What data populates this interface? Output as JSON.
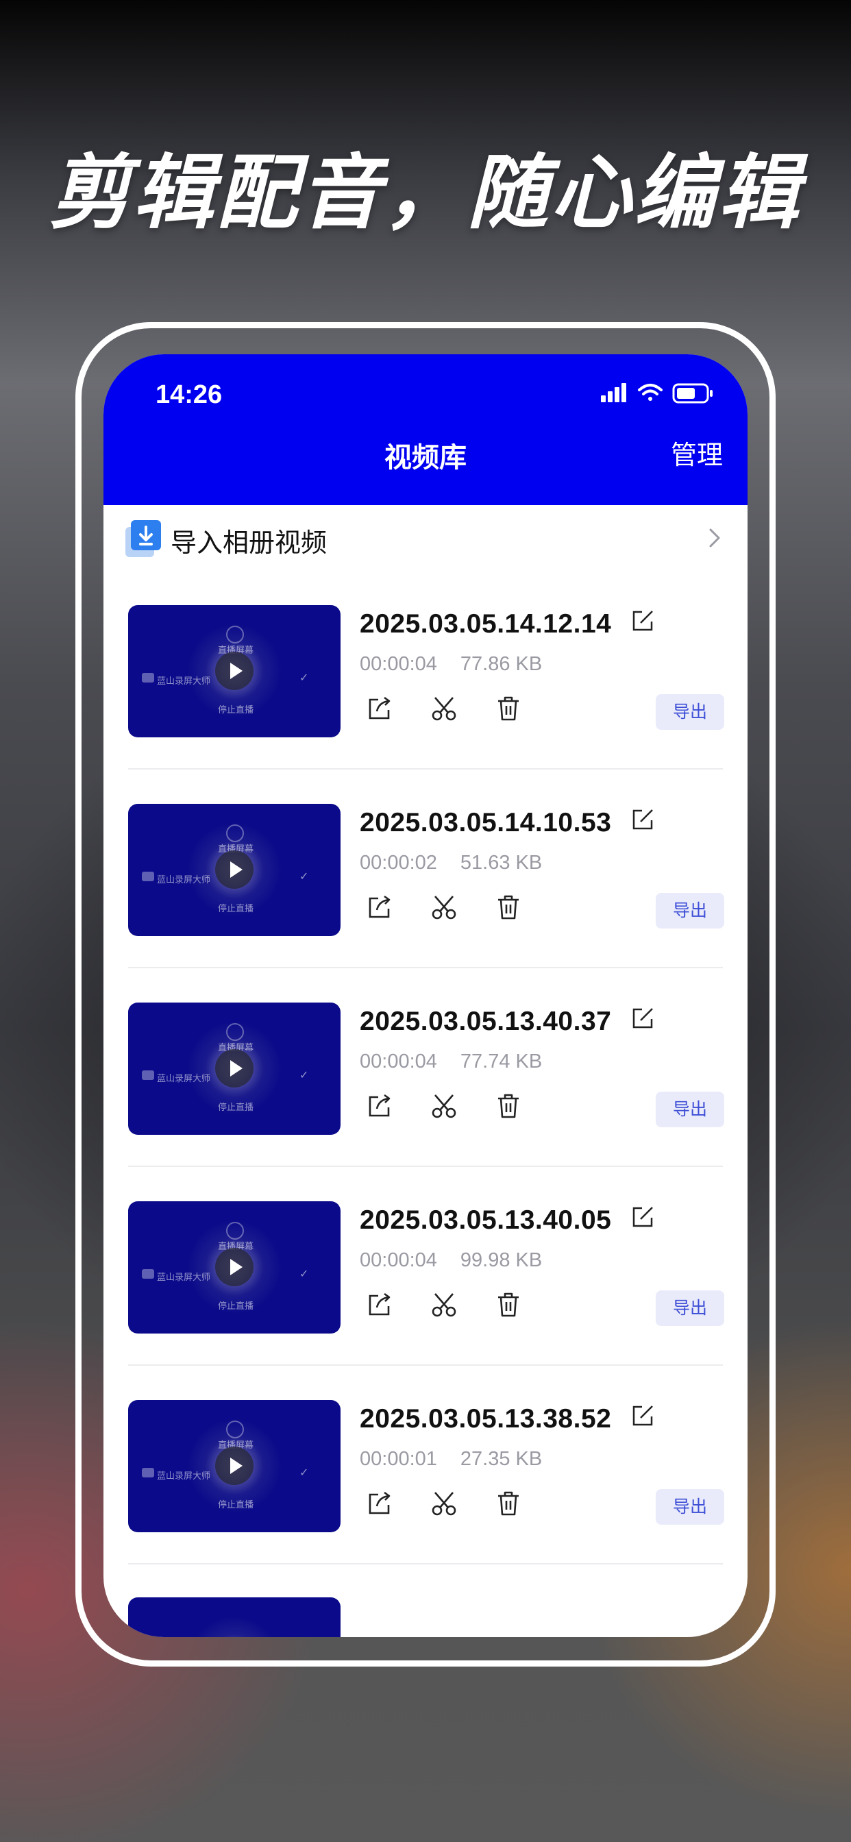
{
  "headline": "剪辑配音，随心编辑",
  "status_bar": {
    "time": "14:26"
  },
  "nav": {
    "title": "视频库",
    "manage_label": "管理"
  },
  "import": {
    "label": "导入相册视频"
  },
  "thumbnail_text": {
    "top": "直播屏幕",
    "left": "蓝山录屏大师",
    "bottom": "停止直播"
  },
  "videos": [
    {
      "name": "2025.03.05.14.12.14",
      "duration": "00:00:04",
      "size": "77.86 KB",
      "export_label": "导出"
    },
    {
      "name": "2025.03.05.14.10.53",
      "duration": "00:00:02",
      "size": "51.63 KB",
      "export_label": "导出"
    },
    {
      "name": "2025.03.05.13.40.37",
      "duration": "00:00:04",
      "size": "77.74 KB",
      "export_label": "导出"
    },
    {
      "name": "2025.03.05.13.40.05",
      "duration": "00:00:04",
      "size": "99.98 KB",
      "export_label": "导出"
    },
    {
      "name": "2025.03.05.13.38.52",
      "duration": "00:00:01",
      "size": "27.35 KB",
      "export_label": "导出"
    }
  ],
  "colors": {
    "nav_bg": "#0000f0",
    "accent": "#3e4fd6",
    "export_bg": "#e9ebfb"
  }
}
